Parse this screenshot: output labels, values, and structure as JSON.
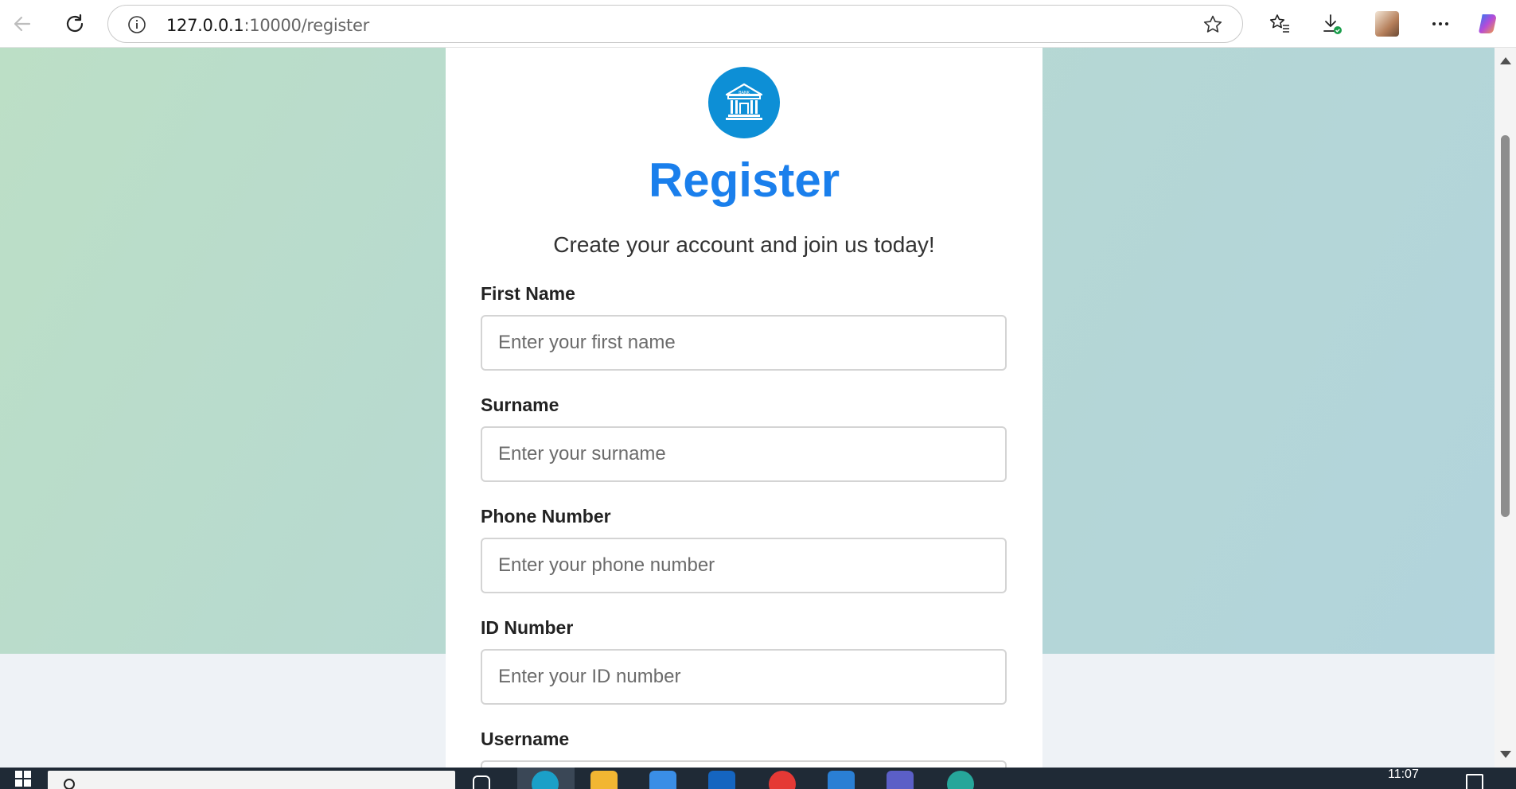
{
  "browser": {
    "url_host": "127.0.0.1",
    "url_path": ":10000/register",
    "icons": [
      "back-icon",
      "refresh-icon",
      "info-icon",
      "star-icon",
      "favorites-icon",
      "downloads-icon",
      "profile-avatar",
      "more-icon",
      "copilot-icon"
    ]
  },
  "form": {
    "logo_text": "BANK",
    "title": "Register",
    "subtitle": "Create your account and join us today!",
    "fields": [
      {
        "label": "First Name",
        "placeholder": "Enter your first name"
      },
      {
        "label": "Surname",
        "placeholder": "Enter your surname"
      },
      {
        "label": "Phone Number",
        "placeholder": "Enter your phone number"
      },
      {
        "label": "ID Number",
        "placeholder": "Enter your ID number"
      },
      {
        "label": "Username",
        "placeholder": ""
      }
    ]
  },
  "taskbar": {
    "time": "11:07"
  },
  "colors": {
    "accent": "#1a7fec",
    "logo_bg": "#0d8fd6",
    "hero_gradient_start": "#bcdfc6",
    "hero_gradient_end": "#b2d4dc",
    "page_bg": "#eef2f6"
  }
}
